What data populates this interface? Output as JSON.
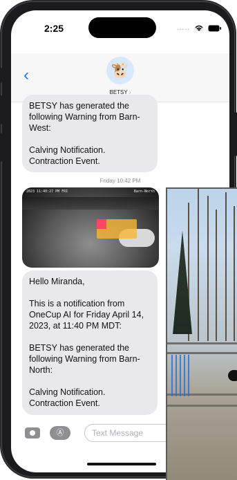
{
  "status": {
    "time": "2:25",
    "dots": "....."
  },
  "header": {
    "back_label": "‹",
    "avatar_emoji": "🐮",
    "contact_name": "BETSY",
    "contact_chevron": "›"
  },
  "messages": [
    {
      "paragraphs": [
        "BETSY has generated the following Warning from Barn-West:",
        "Calving Notification. Contraction Event."
      ]
    },
    {
      "timestamp": "Friday 10:42 PM",
      "image_text_left": "2023 11:40:27 PM FRI",
      "image_text_right": "Barn-North",
      "paragraphs": [
        "Hello Miranda,",
        "This is a notification from OneCup AI for Friday April 14, 2023, at 11:40 PM MDT:",
        "BETSY has generated the following Warning from Barn-North:",
        "Calving Notification. Contraction Event."
      ]
    }
  ],
  "input": {
    "placeholder": "Text Message",
    "apps_label": "Ⓐ"
  },
  "colors": {
    "accent": "#1a7cf5",
    "bubble": "#e9e9eb"
  }
}
